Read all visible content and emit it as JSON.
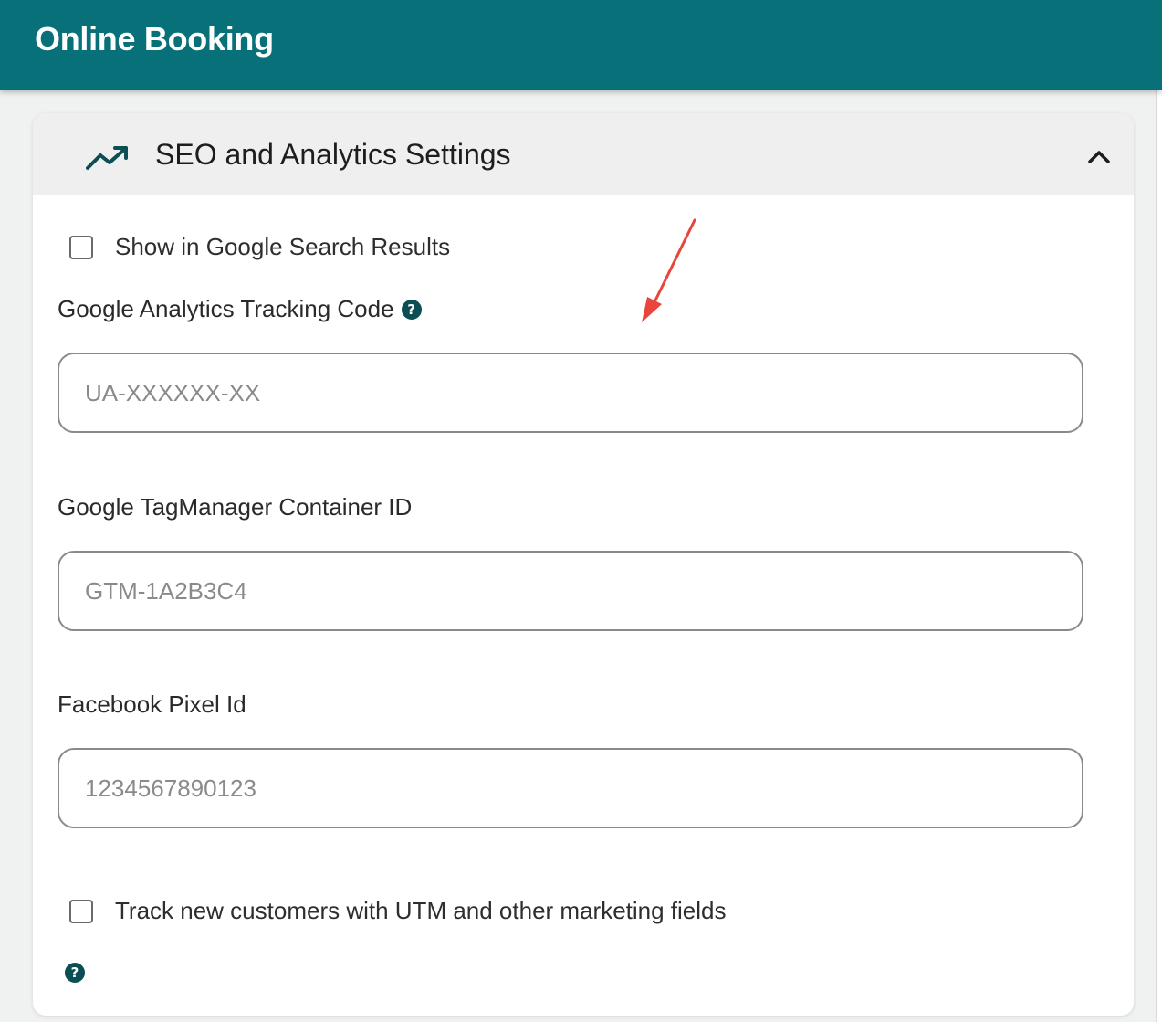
{
  "app": {
    "title": "Online Booking"
  },
  "section": {
    "title": "SEO and Analytics Settings",
    "icon": "trending-up-icon",
    "collapse_icon": "chevron-up-icon",
    "expanded": true
  },
  "seo": {
    "show_in_google_label": "Show in Google Search Results",
    "show_in_google_checked": false
  },
  "fields": {
    "ga": {
      "label": "Google Analytics Tracking Code",
      "placeholder": "UA-XXXXXX-XX",
      "value": "",
      "help_icon": "question-circle-icon"
    },
    "gtm": {
      "label": "Google TagManager Container ID",
      "placeholder": "GTM-1A2B3C4",
      "value": ""
    },
    "fb": {
      "label": "Facebook Pixel Id",
      "placeholder": "1234567890123",
      "value": ""
    }
  },
  "utm": {
    "label": "Track new customers with UTM and other marketing fields",
    "checked": false,
    "help_icon": "question-circle-icon"
  },
  "help_glyph": "?",
  "colors": {
    "header_bg": "#087078",
    "accent_dark": "#0b4f55",
    "annotation_arrow": "#e8453c"
  }
}
